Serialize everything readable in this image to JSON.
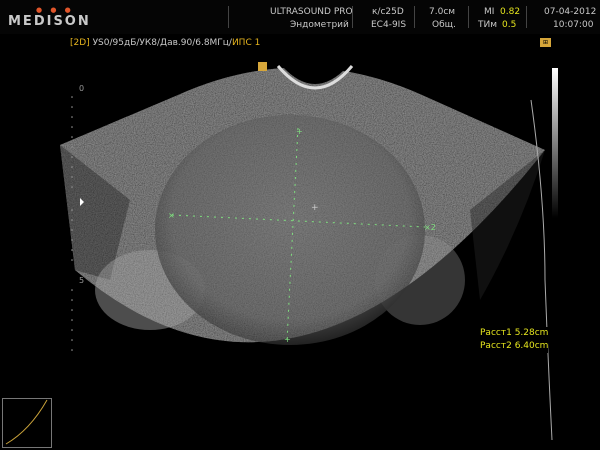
{
  "brand": {
    "name": "MEDISON",
    "dots": "● ● ●"
  },
  "header": {
    "preset": "ULTRASOUND PRO",
    "exam": "Эндометрий",
    "probe_label": "к/с25D",
    "probe": "EC4-9IS",
    "depth": "7.0см",
    "mode": "Общ.",
    "mi_label": "MI",
    "mi_value": "0.82",
    "tib_label": "ТИм",
    "tib_value": "0.5",
    "date": "07-04-2012",
    "time": "10:07:00"
  },
  "params": {
    "mode_tag": "[2D]",
    "settings": "УS0/95дБ/УК8/Дав.90/6.8МГц/",
    "ips": "ИПС 1"
  },
  "badge_icon": "probe-orientation-icon",
  "depth_scale": {
    "top": "0",
    "mid": "5"
  },
  "measurements": [
    {
      "label": "Расст1",
      "value": "5.28cm"
    },
    {
      "label": "Расст2",
      "value": "6.40cm"
    }
  ],
  "colors": {
    "measure": "#e6e61e",
    "param_accent": "#e6b41e",
    "caliper": "#7fe07f"
  }
}
